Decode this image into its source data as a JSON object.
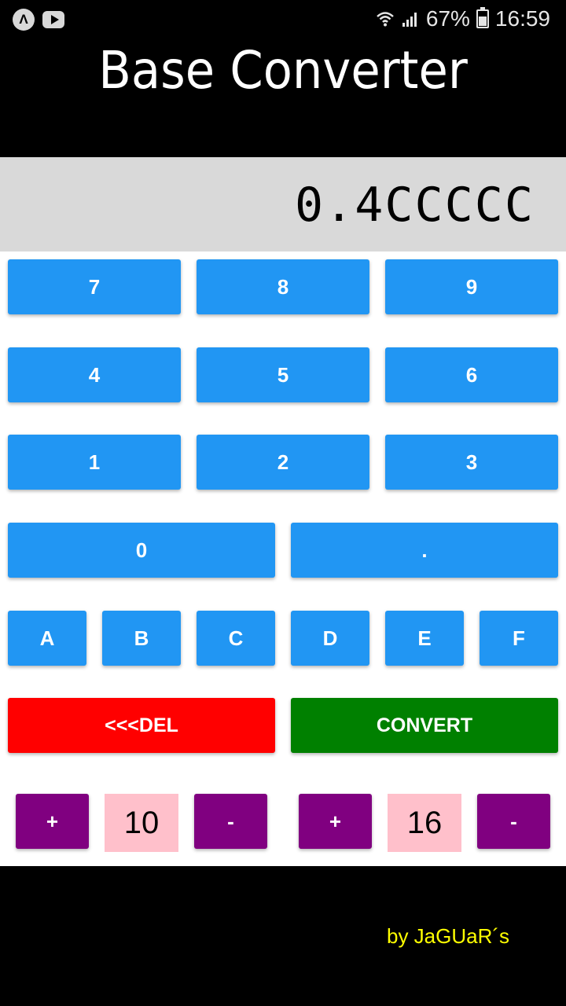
{
  "status_bar": {
    "battery": "67%",
    "time": "16:59",
    "icons": [
      "app-a-icon",
      "youtube-icon",
      "wifi-icon",
      "signal-icon",
      "battery-icon"
    ]
  },
  "header": {
    "title": "Base Converter"
  },
  "display": {
    "value": "0.4CCCCC"
  },
  "keypad": {
    "k7": "7",
    "k8": "8",
    "k9": "9",
    "k4": "4",
    "k5": "5",
    "k6": "6",
    "k1": "1",
    "k2": "2",
    "k3": "3",
    "k0": "0",
    "dot": ".",
    "kA": "A",
    "kB": "B",
    "kC": "C",
    "kD": "D",
    "kE": "E",
    "kF": "F",
    "del": "<<<DEL",
    "convert": "CONVERT"
  },
  "from_base": {
    "plus": "+",
    "value": "10",
    "minus": "-"
  },
  "to_base": {
    "plus": "+",
    "value": "16",
    "minus": "-"
  },
  "footer": {
    "credit": "by JaGUaR´s"
  },
  "colors": {
    "key_blue": "#2196f3",
    "delete_red": "#ff0000",
    "convert_green": "#008000",
    "stepper_purple": "#800080",
    "base_pink": "#ffc0cb",
    "credit_yellow": "#ffff00"
  }
}
